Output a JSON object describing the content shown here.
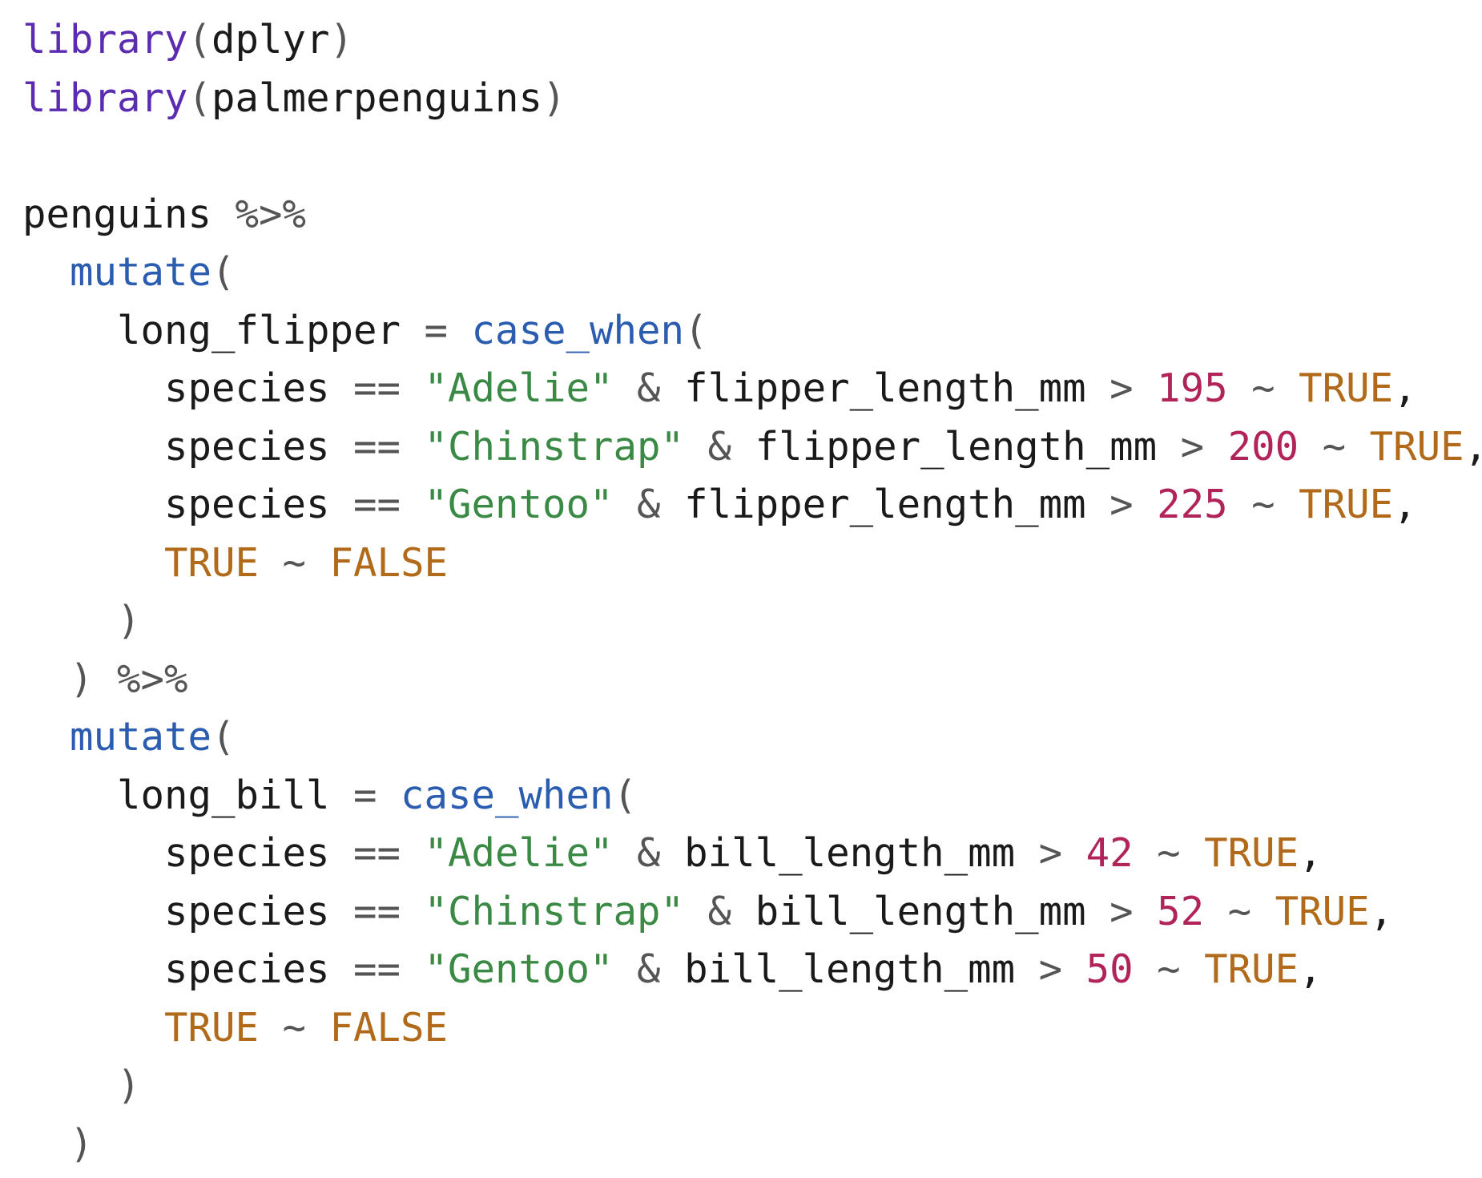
{
  "code": {
    "language": "R",
    "colors": {
      "default": "#1a1a1a",
      "operator": "#555555",
      "keyword": "#5b2bb0",
      "function": "#2a5db0",
      "string": "#3a8a45",
      "number": "#b0245a",
      "constant": "#b06a1a"
    },
    "lines": [
      {
        "tokens": [
          {
            "t": "library",
            "k": "keyword"
          },
          {
            "t": "(",
            "k": "operator"
          },
          {
            "t": "dplyr",
            "k": "default"
          },
          {
            "t": ")",
            "k": "operator"
          }
        ]
      },
      {
        "tokens": [
          {
            "t": "library",
            "k": "keyword"
          },
          {
            "t": "(",
            "k": "operator"
          },
          {
            "t": "palmerpenguins",
            "k": "default"
          },
          {
            "t": ")",
            "k": "operator"
          }
        ]
      },
      {
        "tokens": []
      },
      {
        "tokens": [
          {
            "t": "penguins ",
            "k": "default"
          },
          {
            "t": "%>%",
            "k": "operator"
          }
        ]
      },
      {
        "tokens": [
          {
            "t": "  ",
            "k": "default"
          },
          {
            "t": "mutate",
            "k": "function"
          },
          {
            "t": "(",
            "k": "operator"
          }
        ]
      },
      {
        "tokens": [
          {
            "t": "    long_flipper ",
            "k": "default"
          },
          {
            "t": "= ",
            "k": "operator"
          },
          {
            "t": "case_when",
            "k": "function"
          },
          {
            "t": "(",
            "k": "operator"
          }
        ]
      },
      {
        "tokens": [
          {
            "t": "      species ",
            "k": "default"
          },
          {
            "t": "== ",
            "k": "operator"
          },
          {
            "t": "\"Adelie\"",
            "k": "string"
          },
          {
            "t": " & ",
            "k": "operator"
          },
          {
            "t": "flipper_length_mm ",
            "k": "default"
          },
          {
            "t": "> ",
            "k": "operator"
          },
          {
            "t": "195",
            "k": "number"
          },
          {
            "t": " ~ ",
            "k": "operator"
          },
          {
            "t": "TRUE",
            "k": "constant"
          },
          {
            "t": ",",
            "k": "default"
          }
        ]
      },
      {
        "tokens": [
          {
            "t": "      species ",
            "k": "default"
          },
          {
            "t": "== ",
            "k": "operator"
          },
          {
            "t": "\"Chinstrap\"",
            "k": "string"
          },
          {
            "t": " & ",
            "k": "operator"
          },
          {
            "t": "flipper_length_mm ",
            "k": "default"
          },
          {
            "t": "> ",
            "k": "operator"
          },
          {
            "t": "200",
            "k": "number"
          },
          {
            "t": " ~ ",
            "k": "operator"
          },
          {
            "t": "TRUE",
            "k": "constant"
          },
          {
            "t": ",",
            "k": "default"
          }
        ]
      },
      {
        "tokens": [
          {
            "t": "      species ",
            "k": "default"
          },
          {
            "t": "== ",
            "k": "operator"
          },
          {
            "t": "\"Gentoo\"",
            "k": "string"
          },
          {
            "t": " & ",
            "k": "operator"
          },
          {
            "t": "flipper_length_mm ",
            "k": "default"
          },
          {
            "t": "> ",
            "k": "operator"
          },
          {
            "t": "225",
            "k": "number"
          },
          {
            "t": " ~ ",
            "k": "operator"
          },
          {
            "t": "TRUE",
            "k": "constant"
          },
          {
            "t": ",",
            "k": "default"
          }
        ]
      },
      {
        "tokens": [
          {
            "t": "      ",
            "k": "default"
          },
          {
            "t": "TRUE",
            "k": "constant"
          },
          {
            "t": " ~ ",
            "k": "operator"
          },
          {
            "t": "FALSE",
            "k": "constant"
          }
        ]
      },
      {
        "tokens": [
          {
            "t": "    ",
            "k": "default"
          },
          {
            "t": ")",
            "k": "operator"
          }
        ]
      },
      {
        "tokens": [
          {
            "t": "  ",
            "k": "default"
          },
          {
            "t": ") %>%",
            "k": "operator"
          }
        ]
      },
      {
        "tokens": [
          {
            "t": "  ",
            "k": "default"
          },
          {
            "t": "mutate",
            "k": "function"
          },
          {
            "t": "(",
            "k": "operator"
          }
        ]
      },
      {
        "tokens": [
          {
            "t": "    long_bill ",
            "k": "default"
          },
          {
            "t": "= ",
            "k": "operator"
          },
          {
            "t": "case_when",
            "k": "function"
          },
          {
            "t": "(",
            "k": "operator"
          }
        ]
      },
      {
        "tokens": [
          {
            "t": "      species ",
            "k": "default"
          },
          {
            "t": "== ",
            "k": "operator"
          },
          {
            "t": "\"Adelie\"",
            "k": "string"
          },
          {
            "t": " & ",
            "k": "operator"
          },
          {
            "t": "bill_length_mm ",
            "k": "default"
          },
          {
            "t": "> ",
            "k": "operator"
          },
          {
            "t": "42",
            "k": "number"
          },
          {
            "t": " ~ ",
            "k": "operator"
          },
          {
            "t": "TRUE",
            "k": "constant"
          },
          {
            "t": ",",
            "k": "default"
          }
        ]
      },
      {
        "tokens": [
          {
            "t": "      species ",
            "k": "default"
          },
          {
            "t": "== ",
            "k": "operator"
          },
          {
            "t": "\"Chinstrap\"",
            "k": "string"
          },
          {
            "t": " & ",
            "k": "operator"
          },
          {
            "t": "bill_length_mm ",
            "k": "default"
          },
          {
            "t": "> ",
            "k": "operator"
          },
          {
            "t": "52",
            "k": "number"
          },
          {
            "t": " ~ ",
            "k": "operator"
          },
          {
            "t": "TRUE",
            "k": "constant"
          },
          {
            "t": ",",
            "k": "default"
          }
        ]
      },
      {
        "tokens": [
          {
            "t": "      species ",
            "k": "default"
          },
          {
            "t": "== ",
            "k": "operator"
          },
          {
            "t": "\"Gentoo\"",
            "k": "string"
          },
          {
            "t": " & ",
            "k": "operator"
          },
          {
            "t": "bill_length_mm ",
            "k": "default"
          },
          {
            "t": "> ",
            "k": "operator"
          },
          {
            "t": "50",
            "k": "number"
          },
          {
            "t": " ~ ",
            "k": "operator"
          },
          {
            "t": "TRUE",
            "k": "constant"
          },
          {
            "t": ",",
            "k": "default"
          }
        ]
      },
      {
        "tokens": [
          {
            "t": "      ",
            "k": "default"
          },
          {
            "t": "TRUE",
            "k": "constant"
          },
          {
            "t": " ~ ",
            "k": "operator"
          },
          {
            "t": "FALSE",
            "k": "constant"
          }
        ]
      },
      {
        "tokens": [
          {
            "t": "    ",
            "k": "default"
          },
          {
            "t": ")",
            "k": "operator"
          }
        ]
      },
      {
        "tokens": [
          {
            "t": "  ",
            "k": "default"
          },
          {
            "t": ")",
            "k": "operator"
          }
        ]
      }
    ]
  }
}
